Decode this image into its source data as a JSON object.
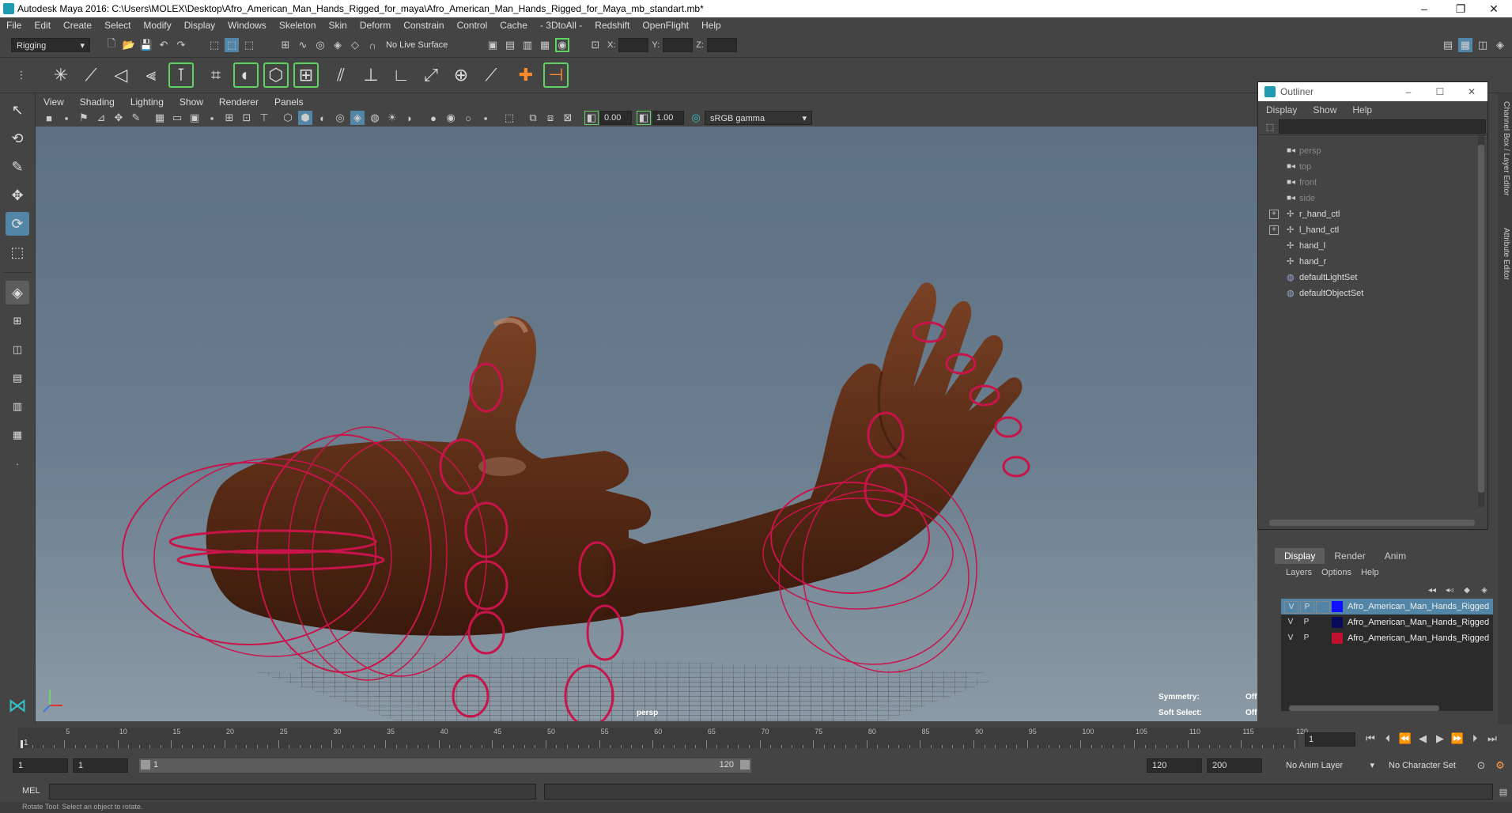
{
  "window": {
    "title": "Autodesk Maya 2016: C:\\Users\\MOLEX\\Desktop\\Afro_American_Man_Hands_Rigged_for_maya\\Afro_American_Man_Hands_Rigged_for_Maya_mb_standart.mb*",
    "minimize": "–",
    "restore": "❐",
    "close": "✕"
  },
  "menubar": [
    "File",
    "Edit",
    "Create",
    "Select",
    "Modify",
    "Display",
    "Windows",
    "Skeleton",
    "Skin",
    "Deform",
    "Constrain",
    "Control",
    "Cache",
    "- 3DtoAll -",
    "Redshift",
    "OpenFlight",
    "Help"
  ],
  "statusline": {
    "menuset": "Rigging",
    "live_surface": "No Live Surface",
    "x_label": "X:",
    "y_label": "Y:",
    "z_label": "Z:"
  },
  "panel_menu": [
    "View",
    "Shading",
    "Lighting",
    "Show",
    "Renderer",
    "Panels"
  ],
  "panel_toolbar": {
    "exposure": "0.00",
    "gamma": "1.00",
    "color_space": "sRGB gamma"
  },
  "viewport": {
    "camera_label": "persp",
    "symmetry_label": "Symmetry:",
    "symmetry_value": "Off",
    "soft_select_label": "Soft Select:",
    "soft_select_value": "Off",
    "skin_color": "#5a2c16",
    "rig_color": "#c8144a"
  },
  "outliner": {
    "title": "Outliner",
    "menus": [
      "Display",
      "Show",
      "Help"
    ],
    "items": [
      {
        "label": "persp",
        "dim": true,
        "icon": "camera-icon",
        "expander": ""
      },
      {
        "label": "top",
        "dim": true,
        "icon": "camera-icon",
        "expander": ""
      },
      {
        "label": "front",
        "dim": true,
        "icon": "camera-icon",
        "expander": ""
      },
      {
        "label": "side",
        "dim": true,
        "icon": "camera-icon",
        "expander": ""
      },
      {
        "label": "r_hand_ctl",
        "dim": false,
        "icon": "transform-icon",
        "expander": "+"
      },
      {
        "label": "l_hand_ctl",
        "dim": false,
        "icon": "transform-icon",
        "expander": "+"
      },
      {
        "label": "hand_l",
        "dim": false,
        "icon": "transform-icon",
        "expander": ""
      },
      {
        "label": "hand_r",
        "dim": false,
        "icon": "transform-icon",
        "expander": ""
      },
      {
        "label": "defaultLightSet",
        "dim": false,
        "icon": "set-icon",
        "expander": ""
      },
      {
        "label": "defaultObjectSet",
        "dim": false,
        "icon": "set-icon",
        "expander": ""
      }
    ]
  },
  "layer_editor": {
    "tabs": [
      "Display",
      "Render",
      "Anim"
    ],
    "menus": [
      "Layers",
      "Options",
      "Help"
    ],
    "layers": [
      {
        "v": "V",
        "p": "P",
        "color": "#1010ff",
        "name": "Afro_American_Man_Hands_Rigged",
        "selected": true
      },
      {
        "v": "V",
        "p": "P",
        "color": "#0a0a5a",
        "name": "Afro_American_Man_Hands_Rigged",
        "selected": false
      },
      {
        "v": "V",
        "p": "P",
        "color": "#c01030",
        "name": "Afro_American_Man_Hands_Rigged",
        "selected": false
      }
    ]
  },
  "right_tabs": [
    "Channel Box / Layer Editor",
    "Attribute Editor"
  ],
  "timeslider": {
    "ticks": [
      "5",
      "10",
      "15",
      "20",
      "25",
      "30",
      "35",
      "40",
      "45",
      "50",
      "55",
      "60",
      "65",
      "70",
      "75",
      "80",
      "85",
      "90",
      "95",
      "100",
      "105",
      "110",
      "115",
      "120"
    ],
    "current_frame_marker": "1",
    "current_frame_field": "1"
  },
  "rangeslider": {
    "start": "1",
    "start_inner": "1",
    "range_start": "1",
    "range_end": "120",
    "end_inner": "120",
    "end": "200",
    "anim_layer": "No Anim Layer",
    "character_set": "No Character Set"
  },
  "cmdline": {
    "label": "MEL"
  },
  "helpline": {
    "text": "Rotate Tool: Select an object to rotate."
  }
}
